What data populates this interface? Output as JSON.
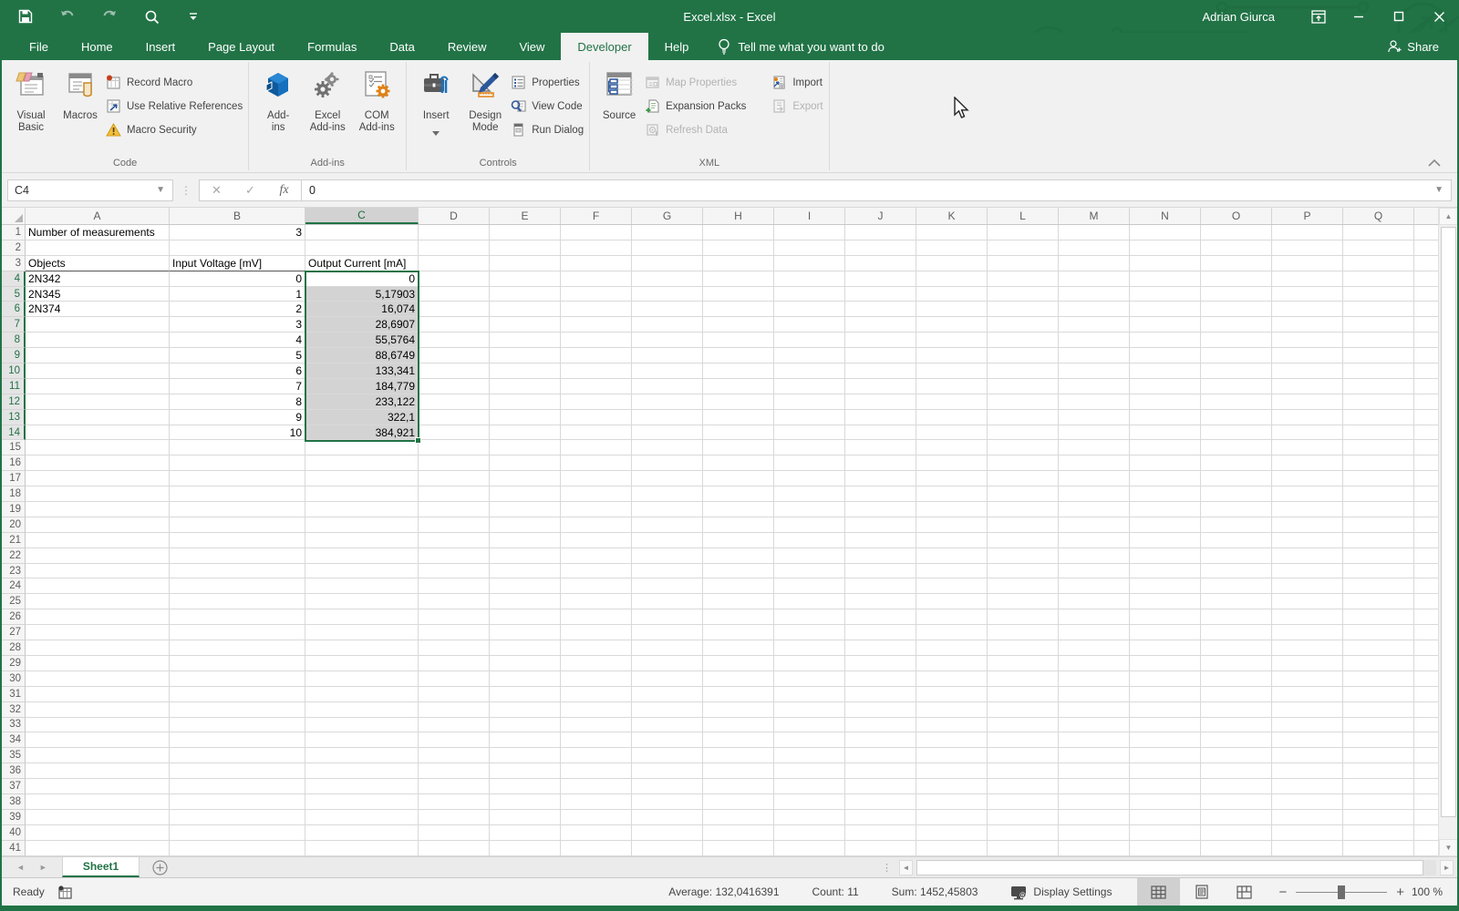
{
  "titlebar": {
    "title": "Excel.xlsx  -  Excel",
    "user": "Adrian Giurca",
    "share_label": "Share",
    "tellme_label": "Tell me what you want to do"
  },
  "tabs": [
    {
      "label": "File"
    },
    {
      "label": "Home"
    },
    {
      "label": "Insert"
    },
    {
      "label": "Page Layout"
    },
    {
      "label": "Formulas"
    },
    {
      "label": "Data"
    },
    {
      "label": "Review"
    },
    {
      "label": "View"
    },
    {
      "label": "Developer",
      "active": true
    },
    {
      "label": "Help"
    }
  ],
  "ribbon": {
    "group_code": "Code",
    "group_addins": "Add-ins",
    "group_controls": "Controls",
    "group_xml": "XML",
    "visual_basic": "Visual\nBasic",
    "macros": "Macros",
    "record_macro": "Record Macro",
    "use_relative_references": "Use Relative References",
    "macro_security": "Macro Security",
    "addins_button": "Add-\nins",
    "excel_addins": "Excel\nAdd-ins",
    "com_addins": "COM\nAdd-ins",
    "insert": "Insert",
    "design_mode": "Design\nMode",
    "properties": "Properties",
    "view_code": "View Code",
    "run_dialog": "Run Dialog",
    "source": "Source",
    "map_properties": "Map Properties",
    "expansion_packs": "Expansion Packs",
    "refresh_data": "Refresh Data",
    "import": "Import",
    "export": "Export"
  },
  "formula_bar": {
    "name_box": "C4",
    "fx_label": "fx",
    "cancel_glyph": "✕",
    "enter_glyph": "✓",
    "value": "0"
  },
  "sheet": {
    "columns": [
      "A",
      "B",
      "C",
      "D",
      "E",
      "F",
      "G",
      "H",
      "I",
      "J",
      "K",
      "L",
      "M",
      "N",
      "O",
      "P",
      "Q"
    ],
    "visible_rows": 41,
    "tab_name": "Sheet1",
    "selection": {
      "range": "C4:C14",
      "active_cell": "C4"
    },
    "cells": {
      "A1": "Number of measurements",
      "B1": "3",
      "A3": "Objects",
      "B3": "Input Voltage [mV]",
      "C3": "Output Current [mA]",
      "A4": "2N342",
      "A5": "2N345",
      "A6": "2N374",
      "B4": "0",
      "B5": "1",
      "B6": "2",
      "B7": "3",
      "B8": "4",
      "B9": "5",
      "B10": "6",
      "B11": "7",
      "B12": "8",
      "B13": "9",
      "B14": "10",
      "C4": "0",
      "C5": "5,17903",
      "C6": "16,074",
      "C7": "28,6907",
      "C8": "55,5764",
      "C9": "88,6749",
      "C10": "133,341",
      "C11": "184,779",
      "C12": "233,122",
      "C13": "322,1",
      "C14": "384,921"
    }
  },
  "status": {
    "ready": "Ready",
    "average": "Average: 132,0416391",
    "count": "Count: 11",
    "sum": "Sum: 1452,45803",
    "display_settings": "Display Settings",
    "zoom_percent": "100 %"
  },
  "colors": {
    "excel_green": "#217346",
    "selection_fill": "#d3d3d3",
    "ribbon_bg": "#f1f1f1"
  }
}
